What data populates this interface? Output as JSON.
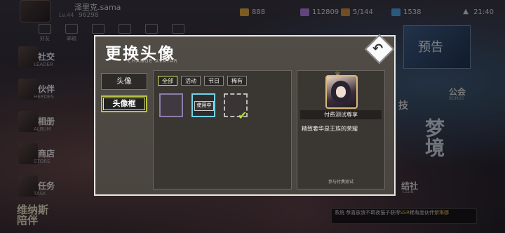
{
  "player": {
    "name": "泽里克.sama",
    "level": "Lv.44",
    "exp": "96298"
  },
  "resources": [
    {
      "icon": "coin-icon",
      "value": "888",
      "color": "#e0a640"
    },
    {
      "icon": "gem-icon",
      "value": "112809",
      "color": "#b080e0"
    },
    {
      "icon": "chest-icon",
      "value": "5/144",
      "color": "#d08a40"
    },
    {
      "icon": "energy-icon",
      "value": "1538",
      "color": "#50a0e0"
    }
  ],
  "status": {
    "time": "21:40"
  },
  "nav": [
    "好友",
    "邮箱",
    "",
    "",
    "",
    ""
  ],
  "left_menu": [
    {
      "title": "社交",
      "sub": "LEADER"
    },
    {
      "title": "伙伴",
      "sub": "HEROES"
    },
    {
      "title": "相册",
      "sub": "ALBUM"
    },
    {
      "title": "商店",
      "sub": "STORE"
    },
    {
      "title": "任务",
      "sub": "TASK"
    }
  ],
  "bottom_left": "维纳斯\n陪伴",
  "right": {
    "banner": "预告",
    "guild": "公会",
    "guild_sub": "BONUS",
    "mode": "梦境",
    "club": "结社",
    "club_sub": "CLUB",
    "side": "技"
  },
  "tip": {
    "prefix": "系统 恭喜放浪不羁夜猫子获得",
    "highlight": "SSR",
    "suffix": "稀有度伙伴",
    "name": "紫琳娜"
  },
  "dialog": {
    "title": "更换头像",
    "subtitle": "CHANGE AVATAR",
    "close_icon": "return-arrow-icon",
    "tabs": [
      "头像",
      "头像框"
    ],
    "active_tab": 1,
    "filters": [
      "全部",
      "活动",
      "节日",
      "稀有"
    ],
    "active_filter": 0,
    "frames": [
      {
        "type": "empty",
        "label": ""
      },
      {
        "type": "inuse",
        "label": "使用中"
      },
      {
        "type": "ornate",
        "label": ""
      }
    ],
    "preview": {
      "name": "付费测试尊享",
      "description": "精致奢华是王族的荣耀",
      "source": "参与付费测试"
    }
  }
}
